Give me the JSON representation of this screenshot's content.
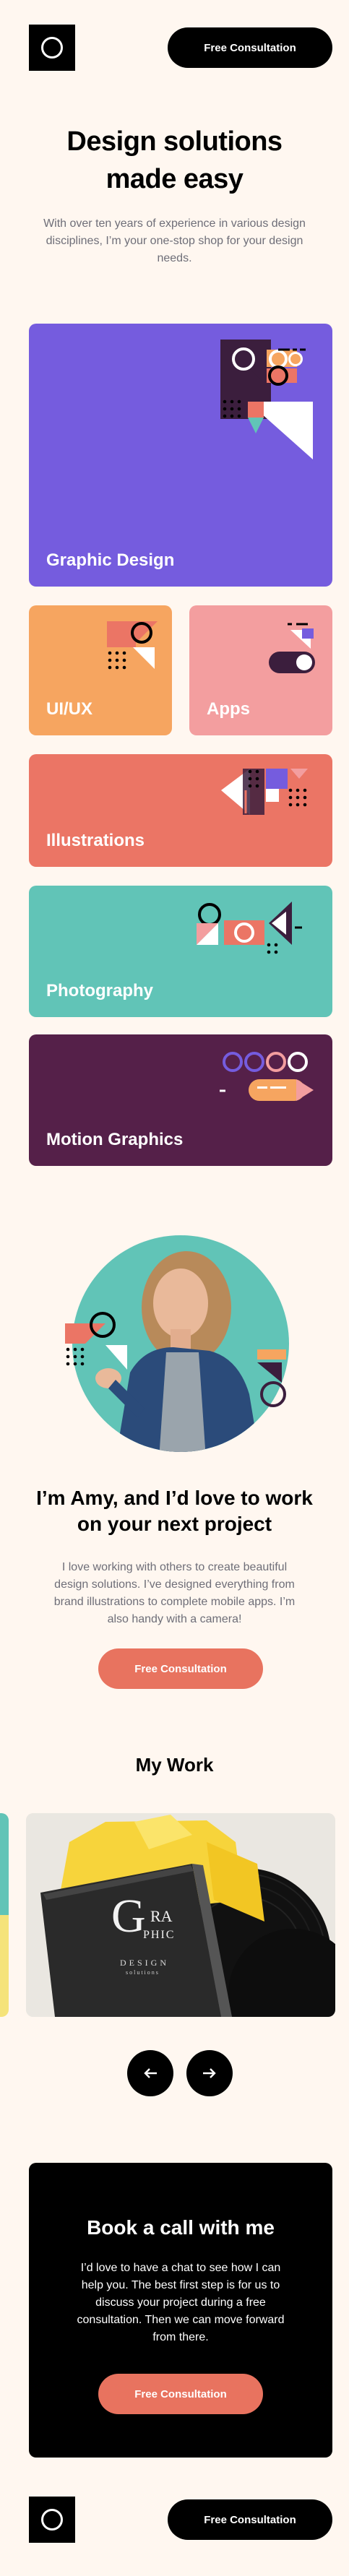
{
  "header": {
    "cta_label": "Free Consultation"
  },
  "hero": {
    "title": "Design solutions made easy",
    "subtitle": "With over ten years of experience in various design disciplines, I’m your one-stop shop for your design needs."
  },
  "services": [
    {
      "label": "Graphic Design",
      "color": "#755CDE"
    },
    {
      "label": "UI/UX",
      "color": "#F6A560"
    },
    {
      "label": "Apps",
      "color": "#F39E9F"
    },
    {
      "label": "Illustrations",
      "color": "#EB7565"
    },
    {
      "label": "Photography",
      "color": "#61C4B7"
    },
    {
      "label": "Motion Graphics",
      "color": "#552049"
    }
  ],
  "about": {
    "title": "I’m Amy, and I’d love to work on your next project",
    "text": "I love working with others to create beautiful design solutions. I’ve designed everything from brand illustrations to complete mobile apps. I’m also handy with a camera!",
    "cta_label": "Free Consultation"
  },
  "work": {
    "title": "My Work",
    "book_cover_text": [
      "G",
      "RA",
      "PHIC",
      "DESIGN",
      "solutions"
    ]
  },
  "booking": {
    "title": "Book a call with me",
    "text": "I’d love to have a chat to see how I can help you. The best first step is for us to discuss your project during a free consultation. Then we can move forward from there.",
    "cta_label": "Free Consultation"
  },
  "footer": {
    "cta_label": "Free Consultation"
  },
  "colors": {
    "background": "#FFF7F0",
    "coral": "#E8735F",
    "black": "#000000"
  }
}
